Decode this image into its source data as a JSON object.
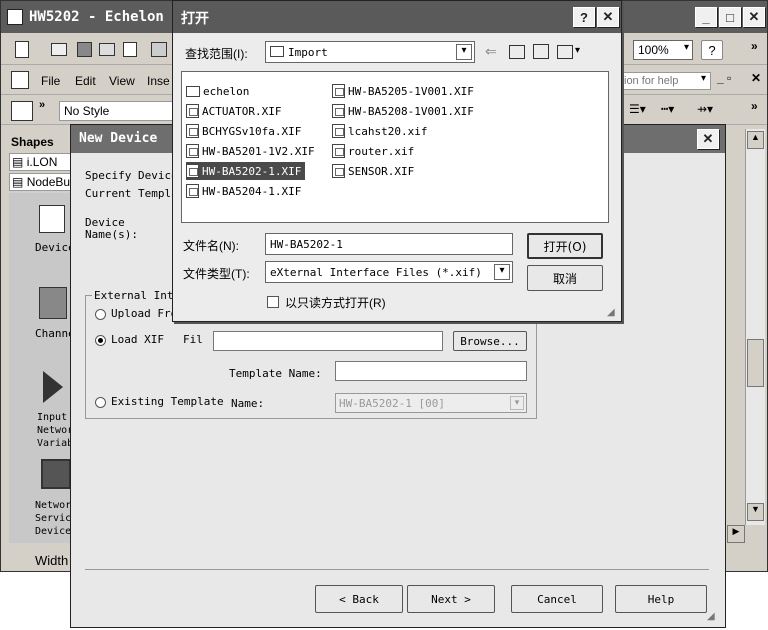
{
  "app": {
    "title": "HW5202 - Echelon",
    "menu": [
      "File",
      "Edit",
      "View",
      "Inse"
    ],
    "zoom": "100%",
    "style_value": "No Style",
    "help_placeholder": "ion for help",
    "status_width": "Width"
  },
  "shapes": {
    "title": "Shapes",
    "groups": [
      "i.LON",
      "NodeBu"
    ],
    "items": [
      {
        "label": "Device",
        "icon": "device-icon"
      },
      {
        "label": "Channe",
        "icon": "channel-icon"
      },
      {
        "label": "Input\nNetwork\nVariabl",
        "icon": "play-triangle-icon"
      },
      {
        "label": "Network\nService\nDevice",
        "icon": "computer-icon"
      }
    ]
  },
  "wizard": {
    "title": "New Device",
    "specify": "Specify Device",
    "current_template": "Current Templa",
    "device_name": "Device\nName(s):",
    "group_label": "External Inte",
    "opt_upload": "Upload Fro",
    "opt_load": "Load XIF",
    "opt_existing": "Existing Template",
    "file_label": "Fil",
    "file_value": "",
    "browse": "Browse...",
    "template_name_label": "Template Name:",
    "template_name_value": "",
    "name_label": "Name:",
    "name_value": "HW-BA5202-1 [00]",
    "btn_back": "< Back",
    "btn_next": "Next >",
    "btn_cancel": "Cancel",
    "btn_help": "Help"
  },
  "open_dialog": {
    "title": "打开",
    "lookin_label": "查找范围(I):",
    "lookin_value": "Import",
    "files": [
      {
        "name": "echelon",
        "type": "folder"
      },
      {
        "name": "ACTUATOR.XIF",
        "type": "file"
      },
      {
        "name": "BCHYGSv10fa.XIF",
        "type": "file"
      },
      {
        "name": "HW-BA5201-1V2.XIF",
        "type": "file"
      },
      {
        "name": "HW-BA5202-1.XIF",
        "type": "file",
        "selected": true
      },
      {
        "name": "HW-BA5204-1.XIF",
        "type": "file"
      },
      {
        "name": "HW-BA5205-1V001.XIF",
        "type": "file"
      },
      {
        "name": "HW-BA5208-1V001.XIF",
        "type": "file"
      },
      {
        "name": "lcahst20.xif",
        "type": "file"
      },
      {
        "name": "router.xif",
        "type": "file"
      },
      {
        "name": "SENSOR.XIF",
        "type": "file"
      }
    ],
    "filename_label": "文件名(N):",
    "filename_value": "HW-BA5202-1",
    "filetype_label": "文件类型(T):",
    "filetype_value": "eXternal Interface Files (*.xif)",
    "readonly_label": "以只读方式打开(R)",
    "open_button": "打开(O)",
    "cancel_button": "取消"
  }
}
